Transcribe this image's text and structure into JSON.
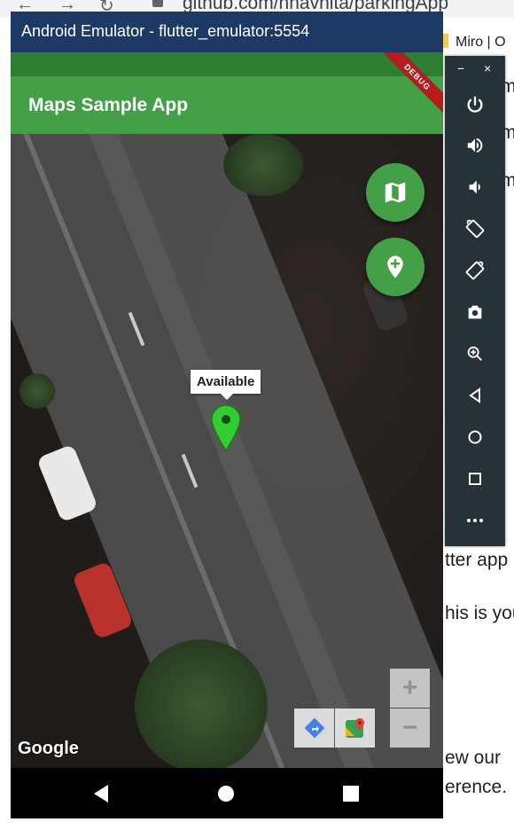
{
  "browser": {
    "url": "github.com/nnavnita/parkingApp",
    "bookmark": "Miro | O",
    "page_lines": [
      "m",
      "m",
      "m",
      "tter app",
      "his is you",
      "ew our",
      "erence."
    ]
  },
  "emulator": {
    "window_title": "Android Emulator - flutter_emulator:5554",
    "debug_banner": "DEBUG"
  },
  "app": {
    "title": "Maps Sample App",
    "marker_info": "Available",
    "google_logo": "Google",
    "zoom_in": "+",
    "zoom_out": "−",
    "accent": "#43a047",
    "status_bar_color": "#2e7d32"
  },
  "side_toolbar": {
    "minimize": "−",
    "close": "×",
    "buttons": [
      "power-icon",
      "volume-up-icon",
      "volume-down-icon",
      "rotate-left-icon",
      "rotate-right-icon",
      "camera-icon",
      "zoom-icon",
      "back-icon",
      "home-icon",
      "overview-icon",
      "more-icon"
    ]
  },
  "navigation": {
    "buttons": [
      "back-icon",
      "home-icon",
      "recents-icon"
    ]
  }
}
